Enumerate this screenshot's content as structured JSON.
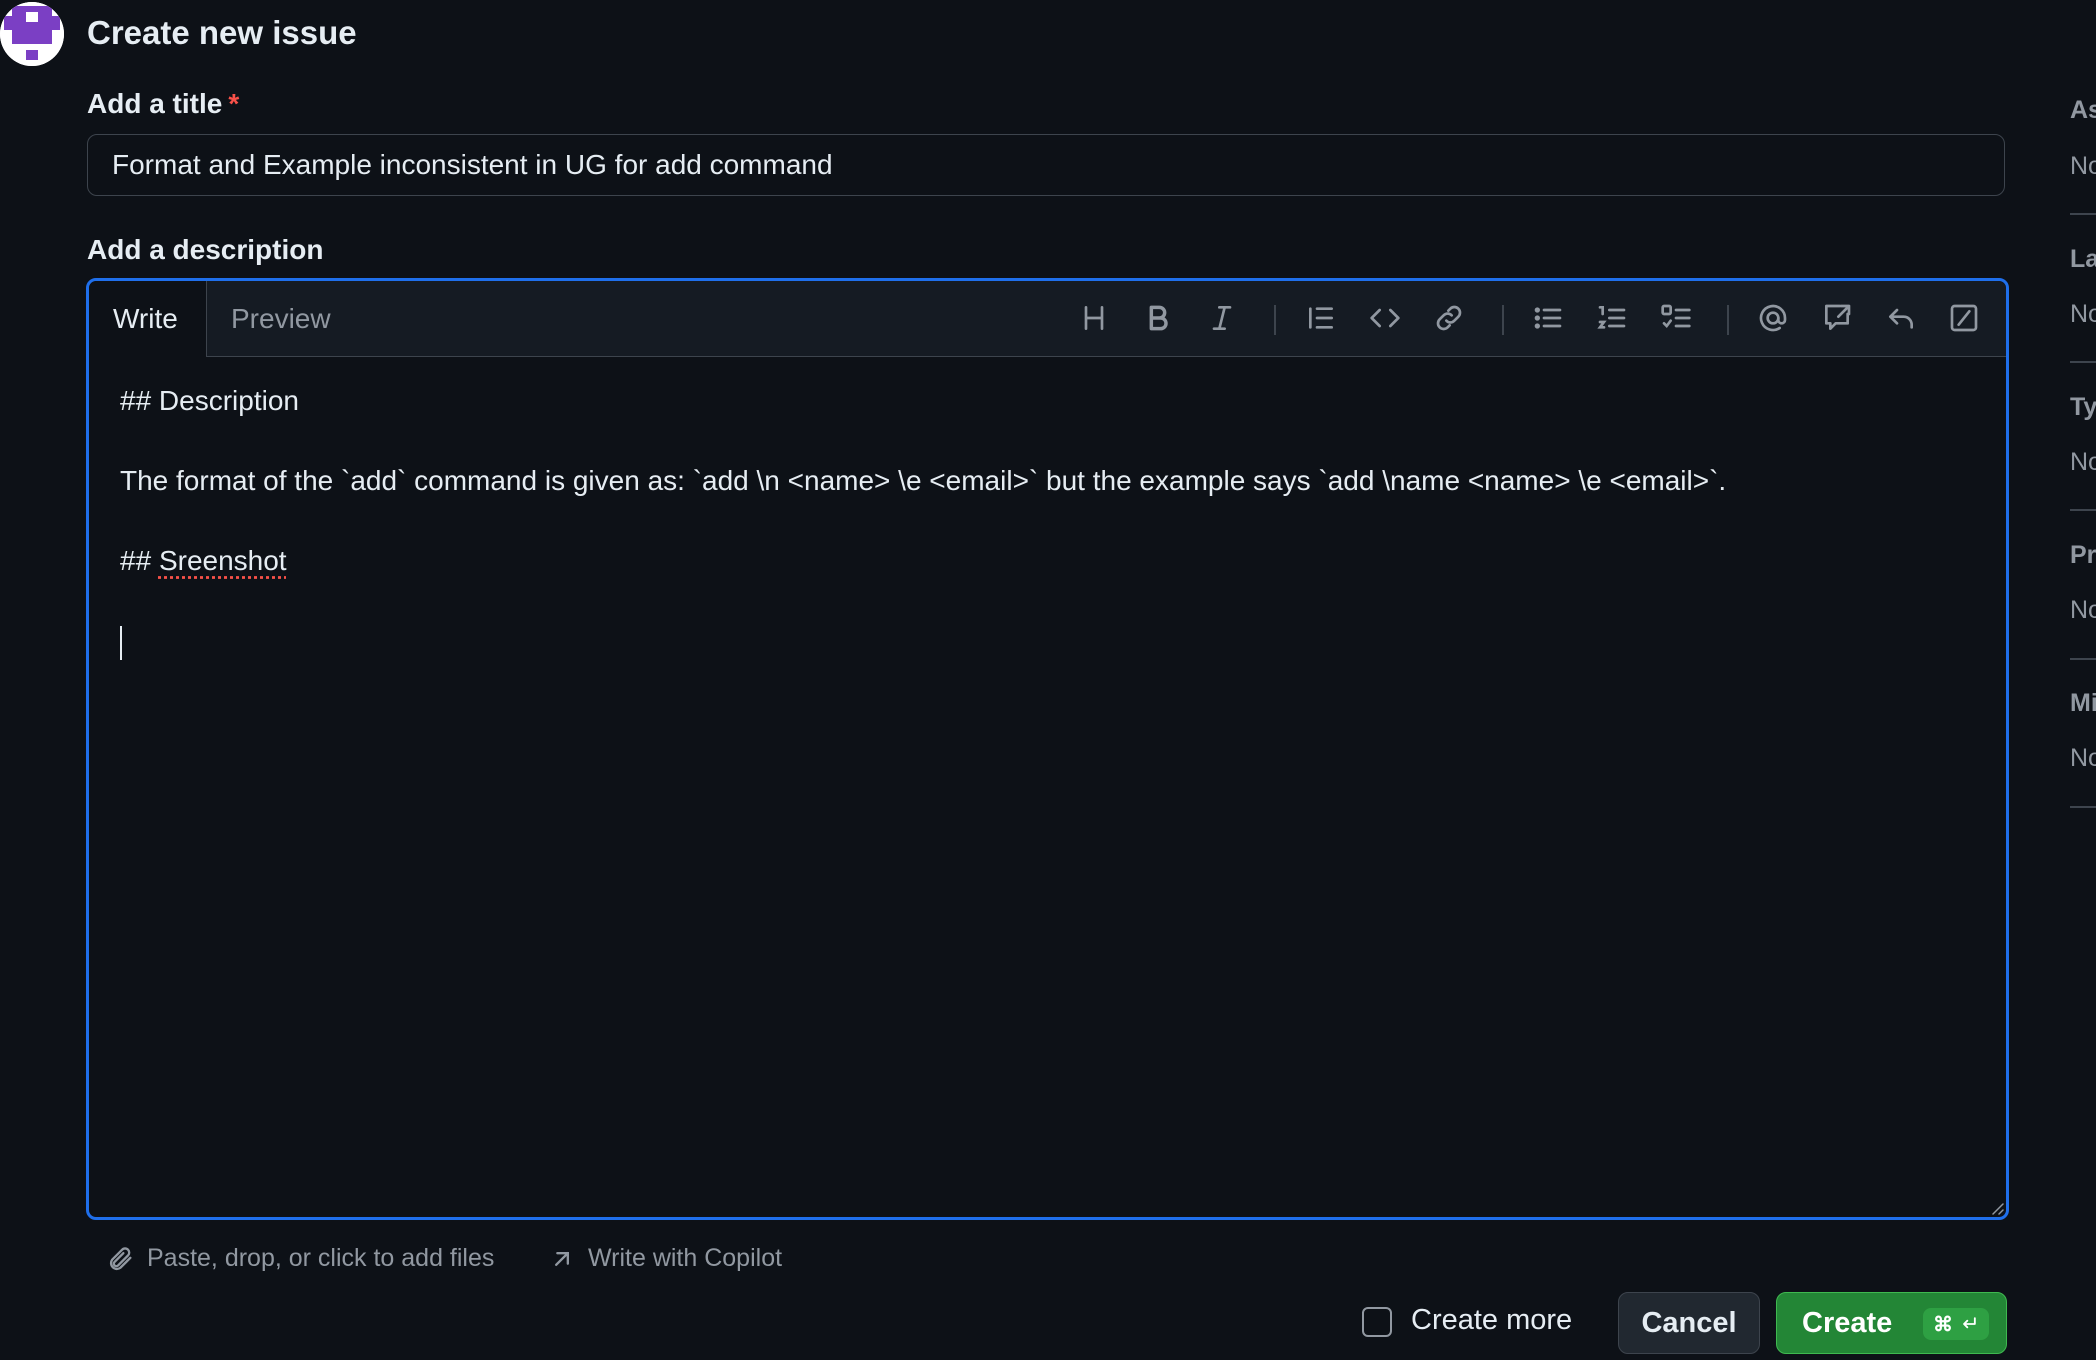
{
  "page": {
    "title": "Create new issue"
  },
  "title_field": {
    "label": "Add a title",
    "required_mark": "*",
    "value": "Format and Example inconsistent in UG for add command"
  },
  "description": {
    "label": "Add a description",
    "tabs": {
      "write": "Write",
      "preview": "Preview"
    },
    "toolbar_icons": [
      "heading-icon",
      "bold-icon",
      "italic-icon",
      "quote-icon",
      "code-icon",
      "link-icon",
      "unordered-list-icon",
      "ordered-list-icon",
      "task-list-icon",
      "mention-icon",
      "reference-icon",
      "saved-replies-icon",
      "slash-commands-icon"
    ],
    "lines": [
      "## Description",
      "The format of the `add` command is given as: `add \\n <name> \\e <email>` but the example says `add \\name <name> \\e <email>`.",
      "## ",
      "Sreenshot"
    ]
  },
  "footer": {
    "attach_label": "Paste, drop, or click to add files",
    "copilot_label": "Write with Copilot"
  },
  "actions": {
    "create_more_label": "Create more",
    "cancel_label": "Cancel",
    "create_label": "Create",
    "create_shortcut_symbol": "⌘"
  },
  "sidebar": {
    "items": [
      {
        "label": "As",
        "value": "No"
      },
      {
        "label": "La",
        "value": "No"
      },
      {
        "label": "Ty",
        "value": "No"
      },
      {
        "label": "Pr",
        "value": "No"
      },
      {
        "label": "Mi",
        "value": "No"
      }
    ]
  },
  "colors": {
    "accent_blue": "#1f6feb",
    "create_green": "#238636",
    "required_red": "#f85149",
    "background": "#0d1117"
  }
}
